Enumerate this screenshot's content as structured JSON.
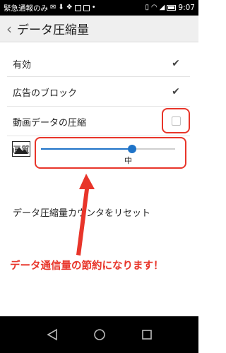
{
  "status_bar": {
    "left_text": "緊急通報のみ",
    "time": "9:07"
  },
  "app_bar": {
    "title": "データ圧縮量"
  },
  "settings": {
    "enabled_label": "有効",
    "enabled_checked": true,
    "adblock_label": "広告のブロック",
    "adblock_checked": true,
    "video_compress_label": "動画データの圧縮",
    "video_compress_checked": false,
    "quality_label": "画質",
    "quality_value": "中",
    "quality_level": 0.68,
    "reset_label": "データ圧縮量カウンタをリセット"
  },
  "annotation": {
    "text": "データ通信量の節約になります！"
  },
  "colors": {
    "accent": "#1e73c8",
    "annotation_red": "#e8352a"
  }
}
